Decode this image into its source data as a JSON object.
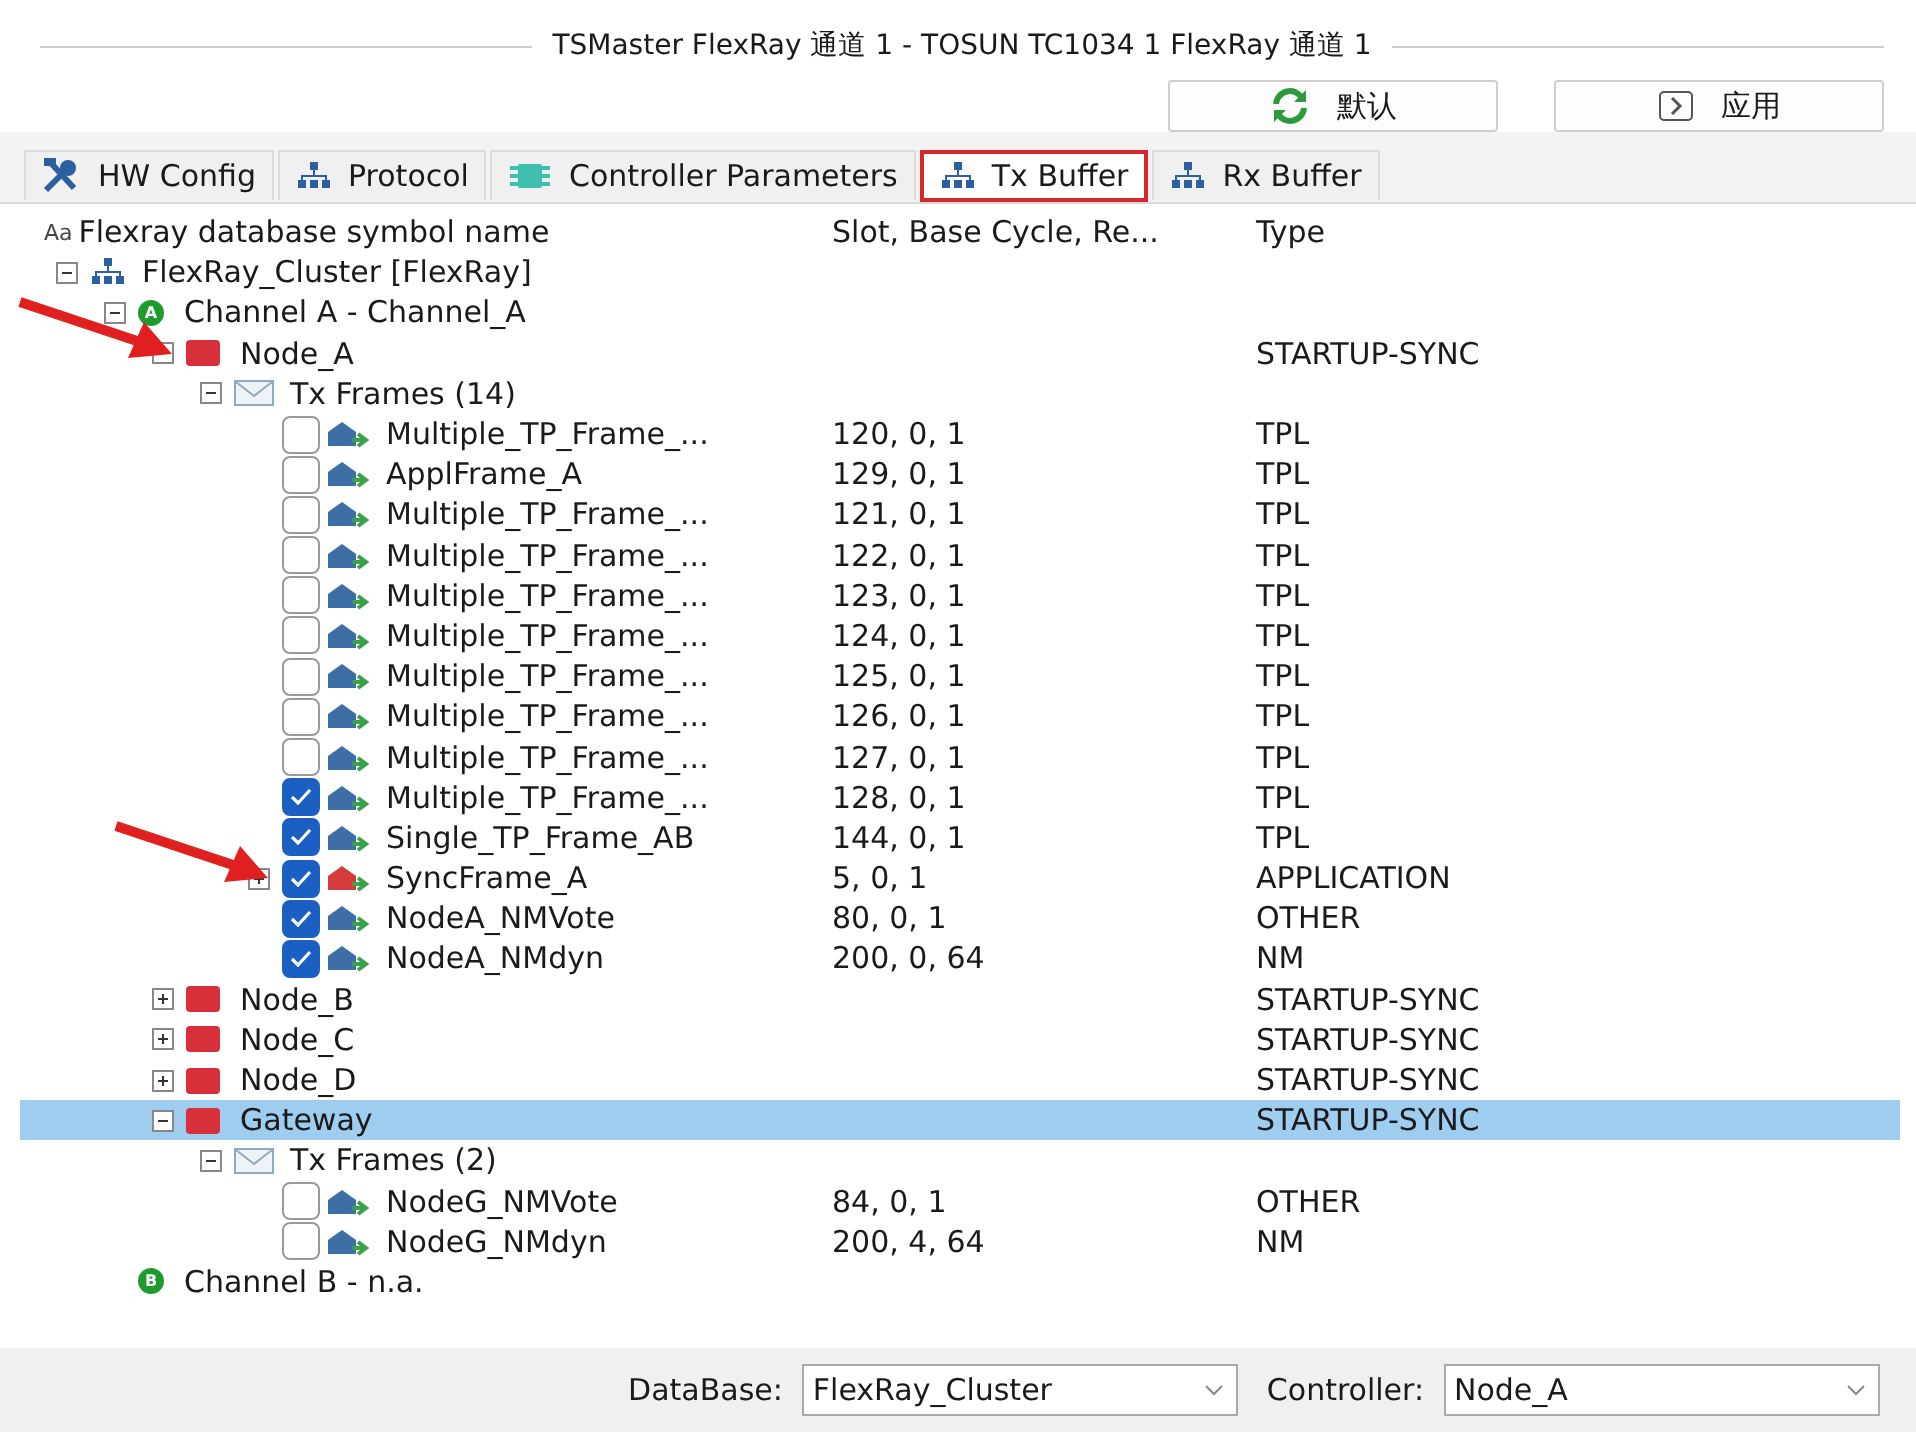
{
  "window": {
    "title": "TSMaster FlexRay 通道 1 - TOSUN TC1034 1 FlexRay 通道 1"
  },
  "buttons": [
    {
      "kind": "reset",
      "label": "默认"
    },
    {
      "kind": "apply",
      "label": "应用"
    }
  ],
  "tabs": [
    {
      "kind": "tools",
      "label": "HW Config",
      "selected": false
    },
    {
      "kind": "network",
      "label": "Protocol",
      "selected": false
    },
    {
      "kind": "chip",
      "label": "Controller Parameters",
      "selected": false
    },
    {
      "kind": "network",
      "label": "Tx Buffer",
      "selected": true
    },
    {
      "kind": "network",
      "label": "Rx Buffer",
      "selected": false
    }
  ],
  "tree": {
    "columns": [
      {
        "badge": "Aa",
        "label": "Flexray database symbol name"
      },
      {
        "label": "Slot, Base Cycle, Re..."
      },
      {
        "label": "Type"
      }
    ],
    "items": [
      {
        "kind": "cluster",
        "label": "FlexRay_Cluster [FlexRay]",
        "expanded": true,
        "selected": false,
        "arrow": false,
        "children": [
          {
            "kind": "channel",
            "badge": "A",
            "label": "Channel A - Channel_A",
            "expanded": true,
            "selected": false,
            "arrow": false,
            "children": [
              {
                "kind": "node",
                "label": "Node_A",
                "type": "STARTUP-SYNC",
                "expanded": true,
                "selected": false,
                "arrow": true,
                "children": [
                  {
                    "kind": "group",
                    "label": "Tx Frames (14)",
                    "expanded": true,
                    "selected": false,
                    "arrow": false,
                    "children": [
                      {
                        "kind": "frame",
                        "label": "Multiple_TP_Frame_...",
                        "slot": "120, 0, 1",
                        "type": "TPL",
                        "checked": false,
                        "color": "#3d6fa6",
                        "selected": false,
                        "arrow": false
                      },
                      {
                        "kind": "frame",
                        "label": "ApplFrame_A",
                        "slot": "129, 0, 1",
                        "type": "TPL",
                        "checked": false,
                        "color": "#3d6fa6",
                        "selected": false,
                        "arrow": false
                      },
                      {
                        "kind": "frame",
                        "label": "Multiple_TP_Frame_...",
                        "slot": "121, 0, 1",
                        "type": "TPL",
                        "checked": false,
                        "color": "#3d6fa6",
                        "selected": false,
                        "arrow": false
                      },
                      {
                        "kind": "frame",
                        "label": "Multiple_TP_Frame_...",
                        "slot": "122, 0, 1",
                        "type": "TPL",
                        "checked": false,
                        "color": "#3d6fa6",
                        "selected": false,
                        "arrow": false
                      },
                      {
                        "kind": "frame",
                        "label": "Multiple_TP_Frame_...",
                        "slot": "123, 0, 1",
                        "type": "TPL",
                        "checked": false,
                        "color": "#3d6fa6",
                        "selected": false,
                        "arrow": false
                      },
                      {
                        "kind": "frame",
                        "label": "Multiple_TP_Frame_...",
                        "slot": "124, 0, 1",
                        "type": "TPL",
                        "checked": false,
                        "color": "#3d6fa6",
                        "selected": false,
                        "arrow": false
                      },
                      {
                        "kind": "frame",
                        "label": "Multiple_TP_Frame_...",
                        "slot": "125, 0, 1",
                        "type": "TPL",
                        "checked": false,
                        "color": "#3d6fa6",
                        "selected": false,
                        "arrow": false
                      },
                      {
                        "kind": "frame",
                        "label": "Multiple_TP_Frame_...",
                        "slot": "126, 0, 1",
                        "type": "TPL",
                        "checked": false,
                        "color": "#3d6fa6",
                        "selected": false,
                        "arrow": false
                      },
                      {
                        "kind": "frame",
                        "label": "Multiple_TP_Frame_...",
                        "slot": "127, 0, 1",
                        "type": "TPL",
                        "checked": false,
                        "color": "#3d6fa6",
                        "selected": false,
                        "arrow": false
                      },
                      {
                        "kind": "frame",
                        "label": "Multiple_TP_Frame_...",
                        "slot": "128, 0, 1",
                        "type": "TPL",
                        "checked": true,
                        "color": "#3d6fa6",
                        "selected": false,
                        "arrow": false
                      },
                      {
                        "kind": "frame",
                        "label": "Single_TP_Frame_AB",
                        "slot": "144, 0, 1",
                        "type": "TPL",
                        "checked": true,
                        "color": "#3d6fa6",
                        "selected": false,
                        "arrow": false
                      },
                      {
                        "kind": "frame",
                        "label": "SyncFrame_A",
                        "slot": "5, 0, 1",
                        "type": "APPLICATION",
                        "checked": true,
                        "color": "#d63b3b",
                        "expanded": false,
                        "selected": false,
                        "arrow": true
                      },
                      {
                        "kind": "frame",
                        "label": "NodeA_NMVote",
                        "slot": "80, 0, 1",
                        "type": "OTHER",
                        "checked": true,
                        "color": "#3d6fa6",
                        "selected": false,
                        "arrow": false
                      },
                      {
                        "kind": "frame",
                        "label": "NodeA_NMdyn",
                        "slot": "200, 0, 64",
                        "type": "NM",
                        "checked": true,
                        "color": "#3d6fa6",
                        "selected": false,
                        "arrow": false
                      }
                    ]
                  }
                ]
              },
              {
                "kind": "node",
                "label": "Node_B",
                "type": "STARTUP-SYNC",
                "expanded": false,
                "selected": false,
                "arrow": false
              },
              {
                "kind": "node",
                "label": "Node_C",
                "type": "STARTUP-SYNC",
                "expanded": false,
                "selected": false,
                "arrow": false
              },
              {
                "kind": "node",
                "label": "Node_D",
                "type": "STARTUP-SYNC",
                "expanded": false,
                "selected": false,
                "arrow": false
              },
              {
                "kind": "node",
                "label": "Gateway",
                "type": "STARTUP-SYNC",
                "expanded": true,
                "selected": true,
                "arrow": false,
                "children": [
                  {
                    "kind": "group",
                    "label": "Tx Frames (2)",
                    "expanded": true,
                    "selected": false,
                    "arrow": false,
                    "children": [
                      {
                        "kind": "frame",
                        "label": "NodeG_NMVote",
                        "slot": "84, 0, 1",
                        "type": "OTHER",
                        "checked": false,
                        "color": "#3d6fa6",
                        "selected": false,
                        "arrow": false
                      },
                      {
                        "kind": "frame",
                        "label": "NodeG_NMdyn",
                        "slot": "200, 4, 64",
                        "type": "NM",
                        "checked": false,
                        "color": "#3d6fa6",
                        "selected": false,
                        "arrow": false
                      }
                    ]
                  }
                ]
              }
            ]
          },
          {
            "kind": "channel",
            "badge": "B",
            "label": "Channel B - n.a.",
            "selected": false,
            "arrow": false
          }
        ]
      }
    ]
  },
  "bottom": [
    {
      "label": "DataBase:",
      "value": "FlexRay_Cluster"
    },
    {
      "label": "Controller:",
      "value": "Node_A"
    }
  ]
}
